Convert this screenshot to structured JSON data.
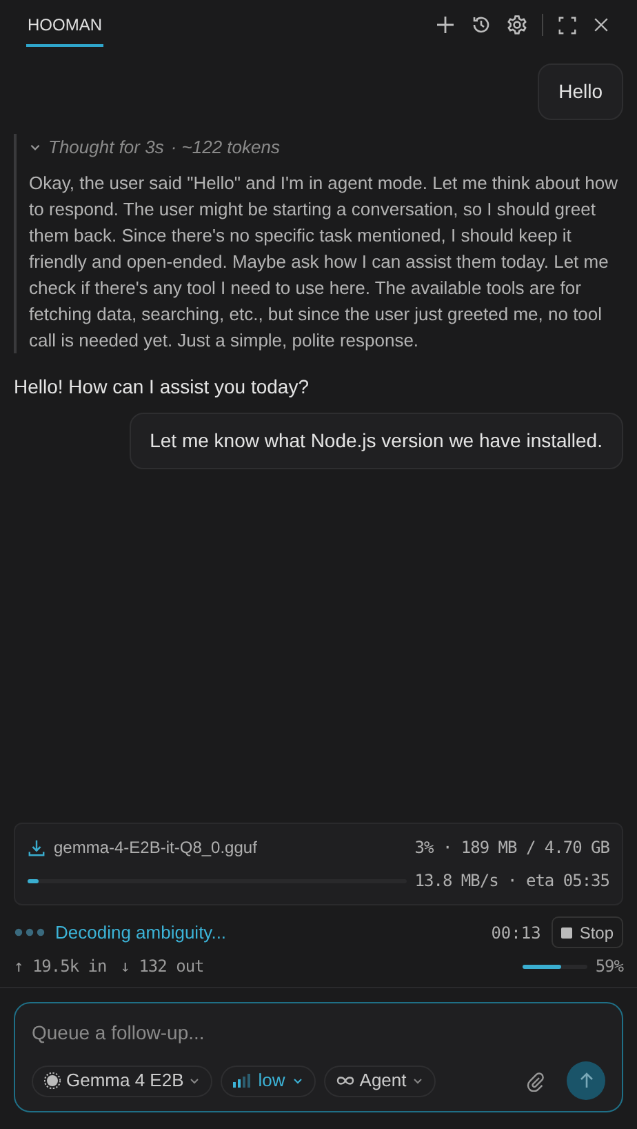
{
  "header": {
    "tabs": [
      {
        "label": "HOOMAN",
        "selected": true
      }
    ]
  },
  "messages": [
    {
      "kind": "user",
      "text": "Hello"
    },
    {
      "kind": "thought",
      "title": "Thought for 3s",
      "meta": "· ~122 tokens",
      "expanded": true,
      "text": "Okay, the user said \"Hello\" and I'm in agent mode. Let me think about how to respond. The user might be starting a conversation, so I should greet them back. Since there's no specific task mentioned, I should keep it friendly and open-ended. Maybe ask how I can assist them today. Let me check if there's any tool I need to use here. The available tools are for fetching data, searching, etc., but since the user just greeted me, no tool call is needed yet. Just a simple, polite response."
    },
    {
      "kind": "assistant",
      "text": "Hello! How can I assist you today?"
    },
    {
      "kind": "user",
      "text": "Let me know what Node.js version we have installed."
    }
  ],
  "download": {
    "file": "gemma-4-E2B-it-Q8_0.gguf",
    "progress": "3% · 189 MB / 4.70 GB",
    "speed": "13.8 MB/s · eta 05:35",
    "level": 0.03
  },
  "status": {
    "label": "Decoding ambiguity...",
    "elapsed": "00:13",
    "stop": "Stop"
  },
  "tokens": {
    "in": "↑ 19.5k in",
    "out": "↓ 132 out",
    "context": {
      "level": 0.59,
      "reading": "59%"
    }
  },
  "composer": {
    "placeholder": "Queue a follow-up...",
    "model": "Gemma 4 E2B",
    "effort": "low",
    "mode": "Agent"
  }
}
